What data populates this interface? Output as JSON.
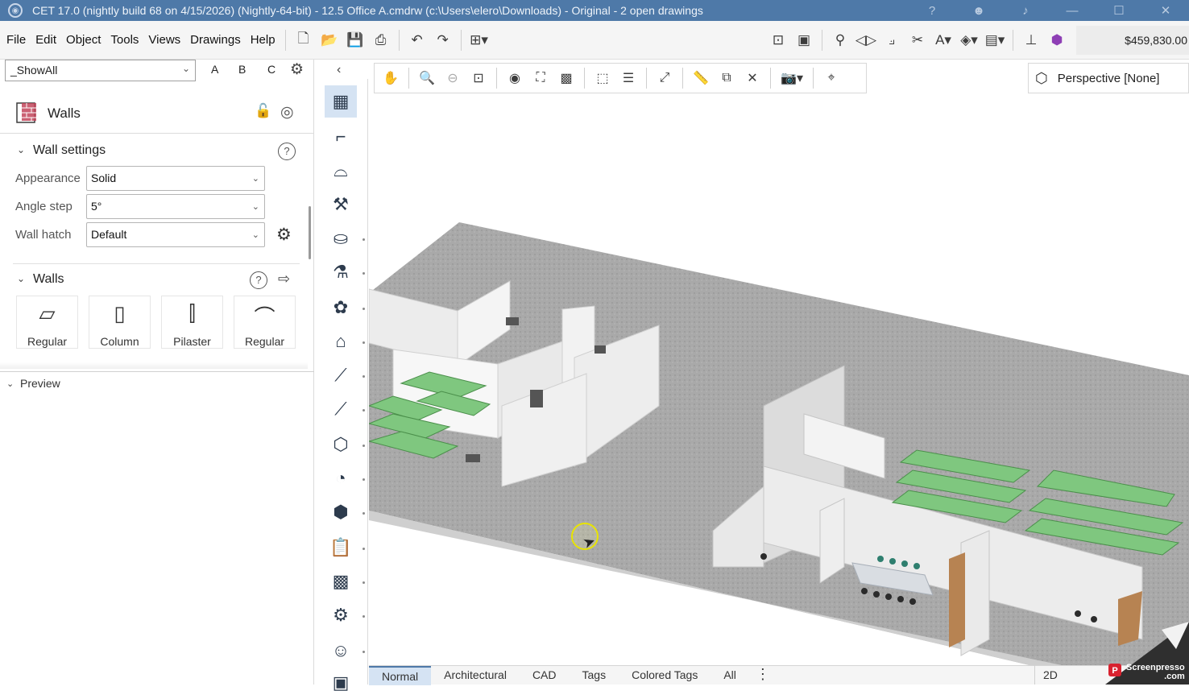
{
  "window": {
    "title": "CET 17.0 (nightly build 68 on 4/15/2026) (Nightly-64-bit) - 12.5 Office A.cmdrw (c:\\Users\\elero\\Downloads) - Original - 2  open drawings"
  },
  "menubar": {
    "items": [
      "File",
      "Edit",
      "Object",
      "Tools",
      "Views",
      "Drawings",
      "Help"
    ],
    "price": "$459,830.00"
  },
  "filter": {
    "selected": "_ShowAll",
    "letters": [
      "A",
      "B",
      "C"
    ]
  },
  "panel": {
    "title": "Walls",
    "wall_settings": {
      "header": "Wall settings",
      "appearance_label": "Appearance",
      "appearance_value": "Solid",
      "angle_label": "Angle step",
      "angle_value": "5°",
      "hatch_label": "Wall hatch",
      "hatch_value": "Default"
    },
    "walls_section": {
      "header": "Walls",
      "tiles": [
        "Regular",
        "Column",
        "Pilaster",
        "Regular"
      ]
    },
    "preview_label": "Preview"
  },
  "viewport": {
    "perspective_label": "Perspective [None]"
  },
  "bottom_tabs": {
    "tabs": [
      "Normal",
      "Architectural",
      "CAD",
      "Tags",
      "Colored Tags",
      "All"
    ],
    "active": "Normal",
    "view_mode": "2D"
  },
  "watermark": {
    "line1": "Screenpresso",
    "line2": ".com"
  },
  "colors": {
    "titlebar": "#4e79a8",
    "active_tab": "#d5e3f3",
    "floor": "#a8a8a8",
    "partition": "#ffffff",
    "cubicle_green": "#7fc77f"
  }
}
